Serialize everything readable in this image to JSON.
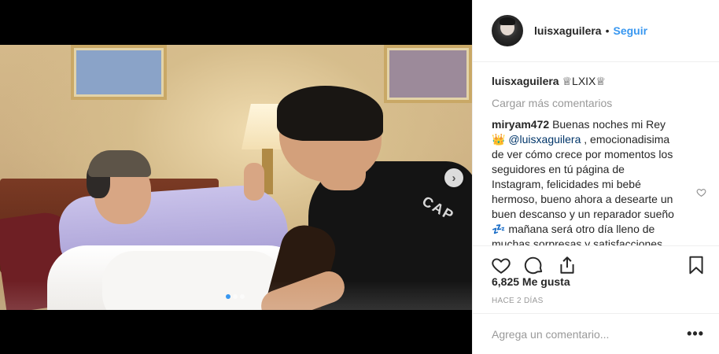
{
  "header": {
    "username": "luisxaguilera",
    "separator": "•",
    "follow_label": "Seguir"
  },
  "caption": {
    "username": "luisxaguilera",
    "text": "♕LXIX♕"
  },
  "load_more_label": "Cargar más comentarios",
  "comment": {
    "username": "miryam472",
    "text_before_mention": "Buenas noches mi Rey 👑",
    "mention": "@luisxaguilera",
    "text_after_mention": ", emocionadisima de ver cómo crece por momentos los seguidores en tú página de Instagram, felicidades mi bebé hermoso, bueno ahora a desearte un buen descanso y un reparador sueño 💤 mañana será otro día lleno de muchas sorpresas y satisfacciones, cómo te lo mereces, te"
  },
  "likes_text": "6,825 Me gusta",
  "time_text": "HACE 2 DÍAS",
  "add_comment_placeholder": "Agrega un comentario...",
  "more_label": "•••",
  "media": {
    "jacket_text": "CAP",
    "next_arrow": "›",
    "carousel_total": 3,
    "carousel_active": 1
  },
  "icons": {
    "like": "heart-icon",
    "comment": "comment-icon",
    "share": "share-icon",
    "save": "bookmark-icon",
    "comment_like": "heart-icon"
  },
  "colors": {
    "accent": "#3897f0",
    "mention": "#003569",
    "muted": "#999999",
    "text": "#262626"
  }
}
